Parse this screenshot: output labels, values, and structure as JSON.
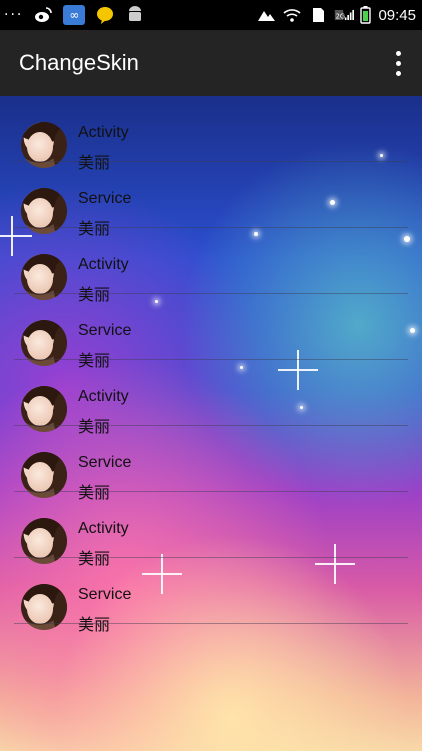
{
  "status_bar": {
    "time": "09:45",
    "dots": "···",
    "network_label": "2G"
  },
  "app_bar": {
    "title": "ChangeSkin"
  },
  "list": {
    "items": [
      {
        "title": "Activity",
        "subtitle": "美丽"
      },
      {
        "title": "Service",
        "subtitle": "美丽"
      },
      {
        "title": "Activity",
        "subtitle": "美丽"
      },
      {
        "title": "Service",
        "subtitle": "美丽"
      },
      {
        "title": "Activity",
        "subtitle": "美丽"
      },
      {
        "title": "Service",
        "subtitle": "美丽"
      },
      {
        "title": "Activity",
        "subtitle": "美丽"
      },
      {
        "title": "Service",
        "subtitle": "美丽"
      }
    ]
  }
}
